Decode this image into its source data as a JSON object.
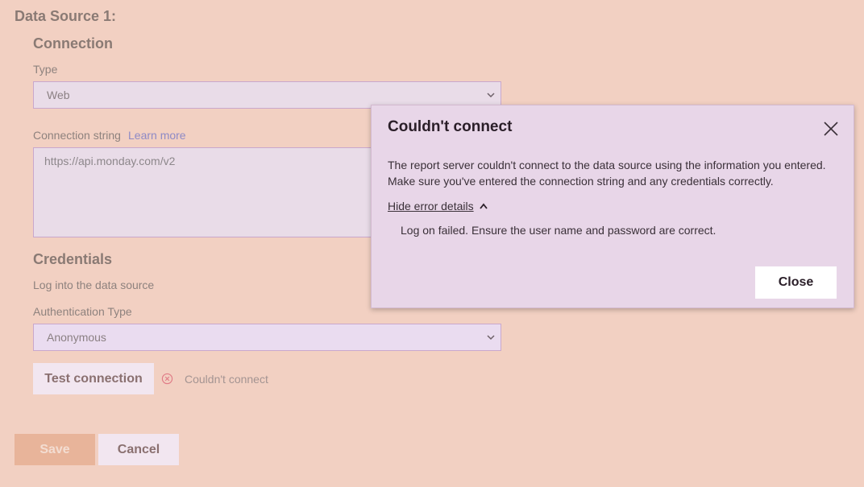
{
  "data_source": {
    "title": "Data Source 1:"
  },
  "connection": {
    "heading": "Connection",
    "type_label": "Type",
    "type_value": "Web",
    "conn_string_label": "Connection string",
    "learn_more": "Learn more",
    "conn_string_value": "https://api.monday.com/v2"
  },
  "credentials": {
    "heading": "Credentials",
    "description": "Log into the data source",
    "auth_type_label": "Authentication Type",
    "auth_type_value": "Anonymous"
  },
  "test": {
    "button_label": "Test connection",
    "status_text": "Couldn't connect",
    "status_icon": "error-circle-icon"
  },
  "actions": {
    "save_label": "Save",
    "cancel_label": "Cancel"
  },
  "dialog": {
    "title": "Couldn't connect",
    "message": "The report server couldn't connect to the data source using the information you entered. Make sure you've entered the connection string and any credentials correctly.",
    "toggle_label": "Hide error details",
    "error_detail": "Log on failed. Ensure the user name and password are correct.",
    "close_label": "Close"
  },
  "colors": {
    "background": "#f2d0c2",
    "dialog_bg": "#e8d6e8",
    "save_bg": "#e8b49a",
    "error_icon": "#e07a86"
  }
}
